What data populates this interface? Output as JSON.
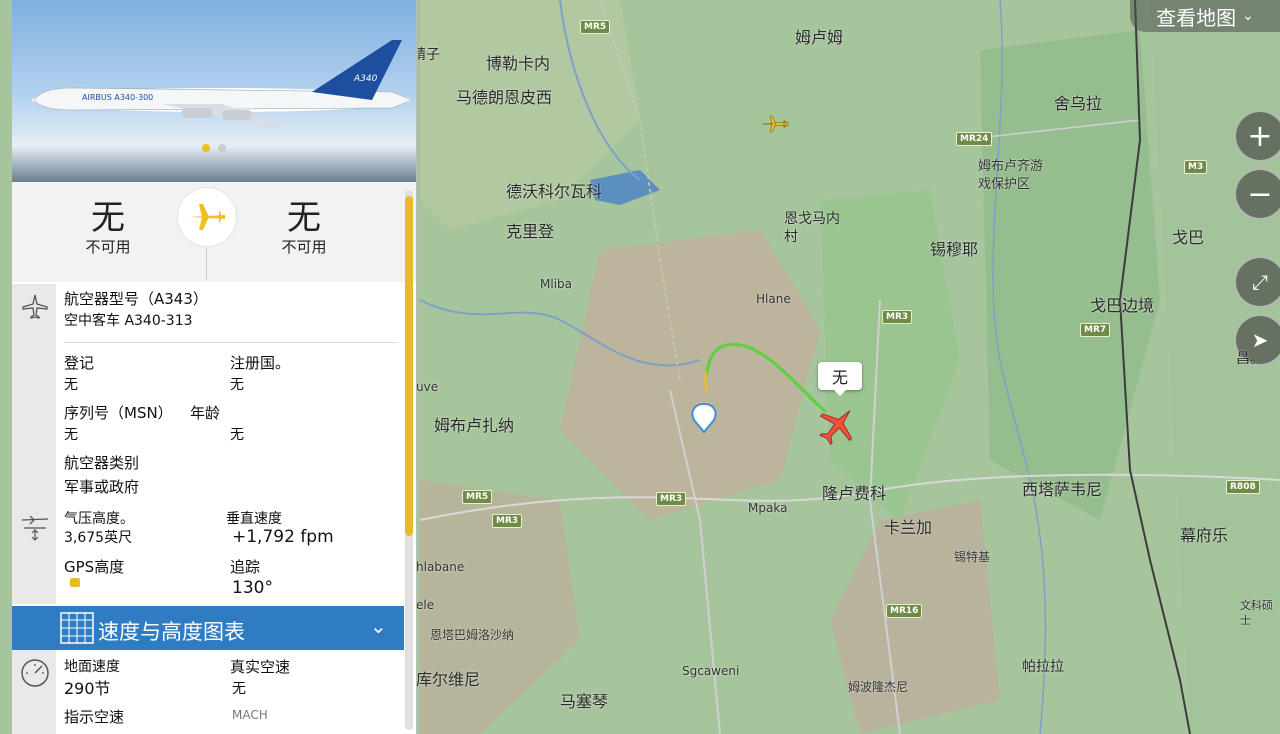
{
  "map": {
    "view_map_label": "查看地图",
    "zoom_in": "+",
    "zoom_out": "−",
    "places": [
      {
        "id": "jingzi",
        "text": "精子"
      },
      {
        "id": "bole",
        "text": "博勒卡内"
      },
      {
        "id": "madelang",
        "text": "马德朗恩皮西"
      },
      {
        "id": "mulumu",
        "text": "姆卢姆"
      },
      {
        "id": "shewula",
        "text": "舍乌拉"
      },
      {
        "id": "reserve",
        "text": "姆布卢齐游\n戏保护区"
      },
      {
        "id": "dewo",
        "text": "德沃科尔瓦科"
      },
      {
        "id": "keli",
        "text": "克里登"
      },
      {
        "id": "engema",
        "text": "恩戈马内\n村"
      },
      {
        "id": "ximu",
        "text": "锡穆耶"
      },
      {
        "id": "geba",
        "text": "戈巴"
      },
      {
        "id": "mliba",
        "text": "Mliba"
      },
      {
        "id": "hlane",
        "text": "Hlane"
      },
      {
        "id": "border",
        "text": "戈巴边境"
      },
      {
        "id": "mubu",
        "text": "姆布卢扎纳"
      },
      {
        "id": "xita",
        "text": "西塔萨韦尼"
      },
      {
        "id": "mpaka",
        "text": "Mpaka"
      },
      {
        "id": "longlu",
        "text": "隆卢费科"
      },
      {
        "id": "kalan",
        "text": "卡兰加"
      },
      {
        "id": "xite",
        "text": "锡特基"
      },
      {
        "id": "mufu",
        "text": "幕府乐"
      },
      {
        "id": "entabo",
        "text": "恩塔巴姆洛沙纳"
      },
      {
        "id": "kuer",
        "text": "库尔维尼"
      },
      {
        "id": "sgc",
        "text": "Sgcaweni"
      },
      {
        "id": "masai",
        "text": "马塞琴"
      },
      {
        "id": "mabo",
        "text": "姆波隆杰尼"
      },
      {
        "id": "pala",
        "text": "帕拉拉"
      },
      {
        "id": "wenke",
        "text": "文科硕\n士"
      },
      {
        "id": "chang",
        "text": "昌。"
      },
      {
        "id": "uve",
        "text": "uve"
      },
      {
        "id": "hlabane",
        "text": "hlabane"
      },
      {
        "id": "ele",
        "text": "ele"
      }
    ],
    "roads": [
      "MR5",
      "MR24",
      "MR3",
      "MR7",
      "MR5",
      "MR3",
      "MR3",
      "MR16",
      "R808",
      "M3"
    ],
    "aircraft_tag": "无"
  },
  "panel": {
    "origin_code": "无",
    "origin_status": "不可用",
    "dest_code": "无",
    "dest_status": "不可用",
    "aircraft_type_label": "航空器型号（A343）",
    "aircraft_type_value": "空中客车 A340-313",
    "reg_label": "登记",
    "reg_value": "无",
    "country_label": "注册国。",
    "country_value": "无",
    "msn_label": "序列号（MSN）",
    "msn_value": "无",
    "age_label": "年龄",
    "age_value": "无",
    "category_label": "航空器类别",
    "category_value": "军事或政府",
    "baro_alt_label": "气压高度。",
    "baro_alt_value": "3,675英尺",
    "vspeed_label": "垂直速度",
    "vspeed_value": "+1,792 fpm",
    "gps_alt_label": "GPS高度",
    "track_label": "追踪",
    "track_value": "130°",
    "chart_bar_label": "速度与高度图表",
    "ground_speed_label": "地面速度",
    "ground_speed_value": "290节",
    "true_airspeed_label": "真实空速",
    "true_airspeed_value": "无",
    "indicated_label": "指示空速",
    "mach_label": "MACH",
    "photo_livery": "AIRBUS A340-300",
    "photo_tail": "A340"
  }
}
